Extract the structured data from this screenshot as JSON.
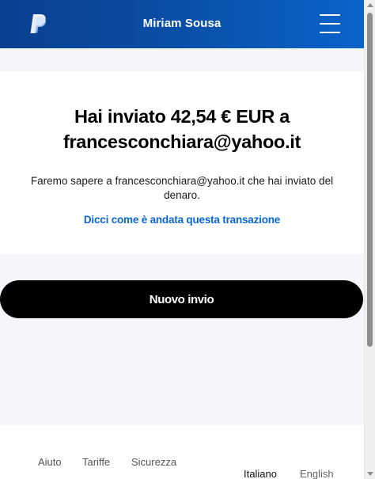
{
  "header": {
    "user_name": "Miriam Sousa",
    "logo_icon": "paypal-logo",
    "menu_icon": "hamburger-menu-icon",
    "colors": {
      "gradient_start": "#0a3f8f",
      "gradient_end": "#0b63c9"
    }
  },
  "confirmation": {
    "headline": "Hai inviato 42,54 € EUR a francesconchiara@yahoo.it",
    "notice": "Faremo sapere a francesconchiara@yahoo.it che hai inviato del denaro.",
    "feedback_link": "Dicci come è andata questa transazione"
  },
  "actions": {
    "new_send_label": "Nuovo invio"
  },
  "footer": {
    "links": [
      "Aiuto",
      "Tariffe",
      "Sicurezza"
    ],
    "languages": [
      "Italiano",
      "English"
    ]
  },
  "colors": {
    "link": "#0b66d6",
    "button_bg": "#000000",
    "page_bg": "#f5f6fa"
  }
}
